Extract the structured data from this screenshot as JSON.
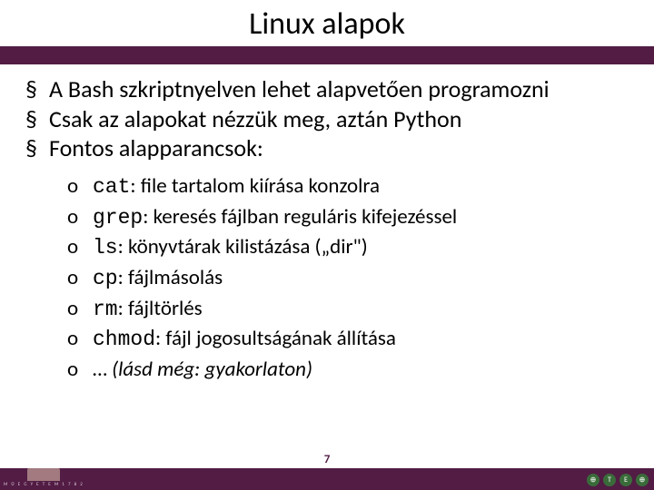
{
  "title": "Linux alapok",
  "bullets": [
    {
      "text": "A Bash szkriptnyelven lehet alapvetően programozni"
    },
    {
      "text": "Csak az alapokat nézzük meg, aztán Python"
    },
    {
      "text": "Fontos alapparancsok:"
    }
  ],
  "commands": [
    {
      "cmd": "cat",
      "desc": "file tartalom kiírása konzolra"
    },
    {
      "cmd": "grep",
      "desc": "keresés fájlban reguláris kifejezéssel"
    },
    {
      "cmd": "ls",
      "desc": "könyvtárak kilistázása („dir\")"
    },
    {
      "cmd": "cp",
      "desc": "fájlmásolás"
    },
    {
      "cmd": "rm",
      "desc": "fájltörlés"
    },
    {
      "cmd": "chmod",
      "desc": "fájl jogosultságának állítása"
    }
  ],
  "more_prefix": "…",
  "more_note": "(lásd még: gyakorlaton)",
  "page_number": "7",
  "footer_left_text": "M Ű E G Y E T E M  1 7 8 2",
  "footer_icons": [
    "⊕",
    "T",
    "E",
    "⊕"
  ]
}
